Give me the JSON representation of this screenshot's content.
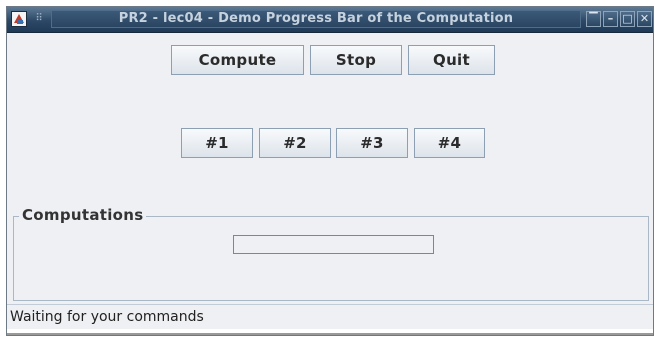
{
  "window": {
    "title": "PR2 - lec04 - Demo Progress Bar of the Computation",
    "app_icon": "java-app-icon",
    "menu_grip": "⠿",
    "controls": {
      "shade": "▔",
      "minimize": "–",
      "maximize": "□",
      "close": "✕"
    }
  },
  "toolbar": {
    "compute_label": "Compute",
    "stop_label": "Stop",
    "quit_label": "Quit"
  },
  "tasks": [
    {
      "label": "#1"
    },
    {
      "label": "#2"
    },
    {
      "label": "#3"
    },
    {
      "label": "#4"
    }
  ],
  "computations": {
    "title": "Computations",
    "progress": 0
  },
  "status": {
    "text": "Waiting for your commands"
  }
}
